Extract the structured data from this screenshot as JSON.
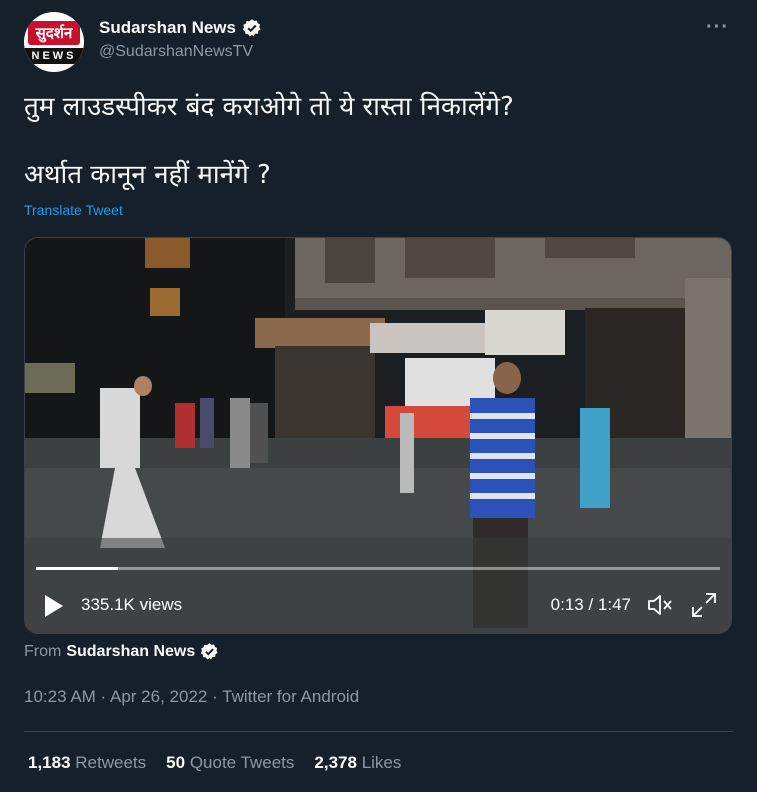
{
  "header": {
    "avatar_top": "सुदर्शन",
    "avatar_bottom": "NEWS",
    "name": "Sudarshan News",
    "handle": "@SudarshanNewsTV",
    "more": "···"
  },
  "tweet": {
    "line1": "तुम लाउडस्पीकर बंद कराओगे तो ये रास्ता निकालेंगे?",
    "line2": "अर्थात कानून नहीं मानेंगे ?",
    "translate": "Translate Tweet"
  },
  "video": {
    "views": "335.1K views",
    "time": "0:13 / 1:47",
    "progress": 0.12
  },
  "source": {
    "prefix": "From",
    "name": "Sudarshan News"
  },
  "meta": {
    "text": "10:23 AM · Apr 26, 2022 · Twitter for Android"
  },
  "stats": {
    "retweets_count": "1,183",
    "retweets_label": "Retweets",
    "quotes_count": "50",
    "quotes_label": "Quote Tweets",
    "likes_count": "2,378",
    "likes_label": "Likes"
  },
  "colors": {
    "background": "#15202b",
    "link": "#1d9bf0",
    "secondary_text": "#8b98a5",
    "verified": "#f7f9f9"
  }
}
